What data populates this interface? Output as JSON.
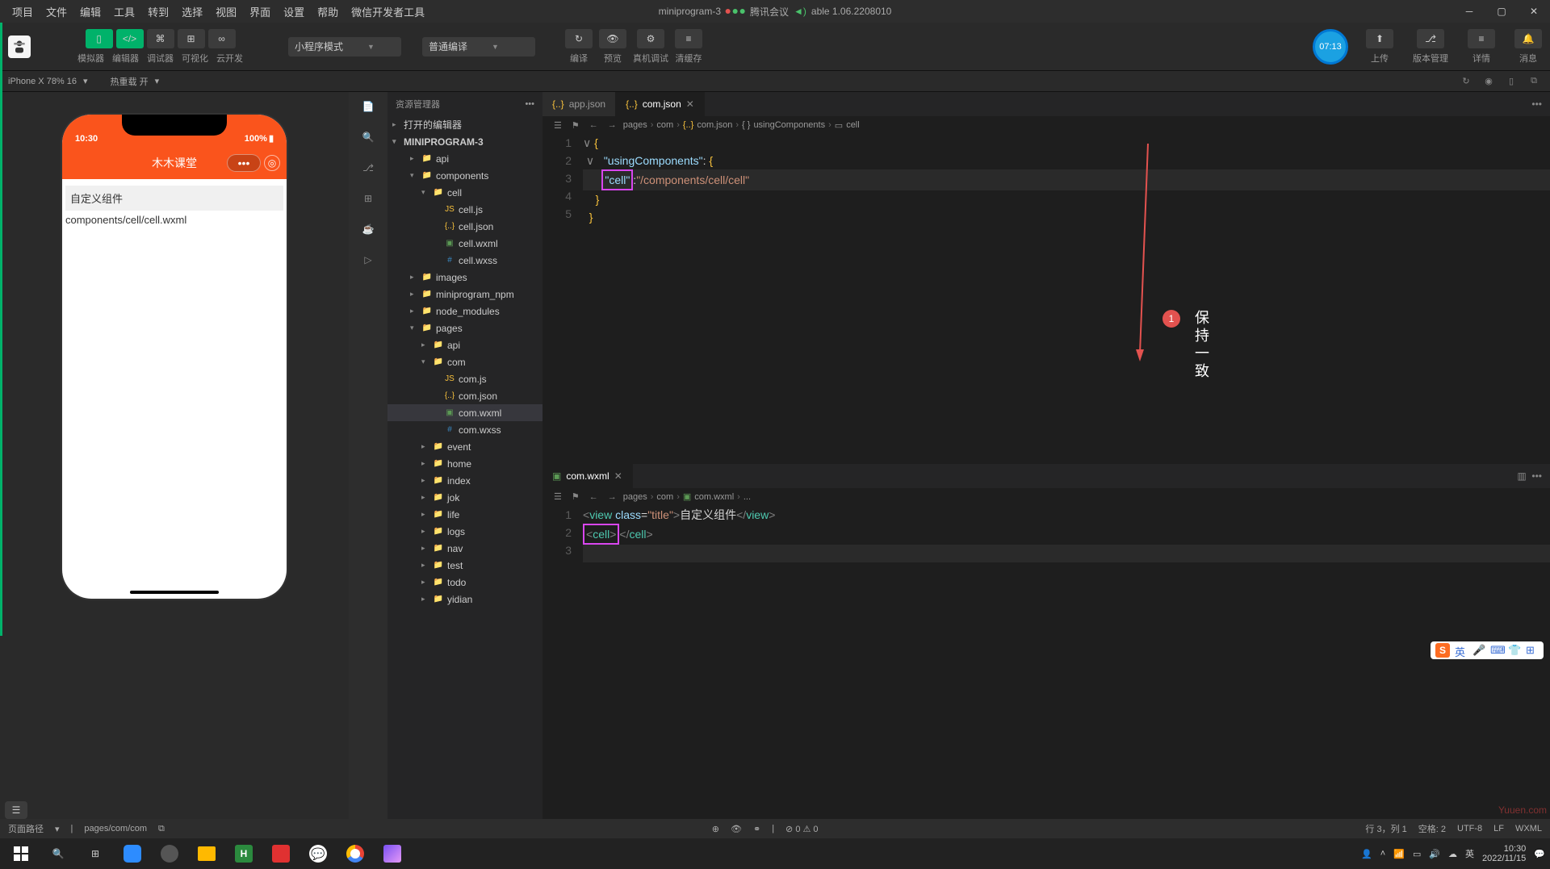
{
  "menubar": {
    "items": [
      "项目",
      "文件",
      "编辑",
      "工具",
      "转到",
      "选择",
      "视图",
      "界面",
      "设置",
      "帮助",
      "微信开发者工具"
    ],
    "projectName": "miniprogram-3",
    "meetingLabel": "腾讯会议",
    "versionLabel": "able 1.06.2208010"
  },
  "toolbar": {
    "group1Labels": [
      "模拟器",
      "编辑器",
      "调试器",
      "可视化",
      "云开发"
    ],
    "dropdown1": "小程序模式",
    "dropdown2": "普通编译",
    "group2Labels": [
      "编译",
      "预览",
      "真机调试",
      "清缓存"
    ],
    "rightLabels": [
      "上传",
      "版本管理",
      "详情",
      "消息"
    ],
    "badgeTime": "07:13"
  },
  "subToolbar": {
    "device": "iPhone X 78% 16",
    "hotReload": "热重载 开"
  },
  "phone": {
    "time": "10:30",
    "battery": "100%",
    "title": "木木课堂",
    "contentTitle": "自定义组件",
    "contentPath": "components/cell/cell.wxml"
  },
  "explorer": {
    "header": "资源管理器",
    "section1": "打开的编辑器",
    "root": "MINIPROGRAM-3",
    "tree": [
      {
        "name": "api",
        "type": "folder",
        "depth": 1,
        "open": false
      },
      {
        "name": "components",
        "type": "folder",
        "depth": 1,
        "open": true
      },
      {
        "name": "cell",
        "type": "folder",
        "depth": 2,
        "open": true
      },
      {
        "name": "cell.js",
        "type": "js",
        "depth": 3
      },
      {
        "name": "cell.json",
        "type": "json",
        "depth": 3
      },
      {
        "name": "cell.wxml",
        "type": "wxml",
        "depth": 3
      },
      {
        "name": "cell.wxss",
        "type": "wxss",
        "depth": 3
      },
      {
        "name": "images",
        "type": "folder",
        "depth": 1,
        "open": false
      },
      {
        "name": "miniprogram_npm",
        "type": "folder",
        "depth": 1,
        "open": false
      },
      {
        "name": "node_modules",
        "type": "folder",
        "depth": 1,
        "open": false
      },
      {
        "name": "pages",
        "type": "folder",
        "depth": 1,
        "open": true
      },
      {
        "name": "api",
        "type": "folder",
        "depth": 2,
        "open": false
      },
      {
        "name": "com",
        "type": "folder",
        "depth": 2,
        "open": true
      },
      {
        "name": "com.js",
        "type": "js",
        "depth": 3
      },
      {
        "name": "com.json",
        "type": "json",
        "depth": 3
      },
      {
        "name": "com.wxml",
        "type": "wxml",
        "depth": 3,
        "selected": true
      },
      {
        "name": "com.wxss",
        "type": "wxss",
        "depth": 3
      },
      {
        "name": "event",
        "type": "folder",
        "depth": 2,
        "open": false
      },
      {
        "name": "home",
        "type": "folder",
        "depth": 2,
        "open": false
      },
      {
        "name": "index",
        "type": "folder",
        "depth": 2,
        "open": false
      },
      {
        "name": "jok",
        "type": "folder",
        "depth": 2,
        "open": false
      },
      {
        "name": "life",
        "type": "folder",
        "depth": 2,
        "open": false
      },
      {
        "name": "logs",
        "type": "folder",
        "depth": 2,
        "open": false
      },
      {
        "name": "nav",
        "type": "folder",
        "depth": 2,
        "open": false
      },
      {
        "name": "test",
        "type": "folder",
        "depth": 2,
        "open": false
      },
      {
        "name": "todo",
        "type": "folder",
        "depth": 2,
        "open": false
      },
      {
        "name": "yidian",
        "type": "folder",
        "depth": 2,
        "open": false
      }
    ]
  },
  "editor1": {
    "tab1": "app.json",
    "tab2": "com.json",
    "breadcrumb": [
      "pages",
      "com",
      "com.json",
      "usingComponents",
      "cell"
    ],
    "lines": [
      "1",
      "2",
      "3",
      "4",
      "5"
    ],
    "code": {
      "usingComponents": "\"usingComponents\"",
      "cellKey": "\"cell\"",
      "cellVal": "\"/components/cell/cell\""
    }
  },
  "annotation": {
    "num": "1",
    "text": "保持一致"
  },
  "editor2": {
    "tab1": "com.wxml",
    "breadcrumb": [
      "pages",
      "com",
      "com.wxml",
      "..."
    ],
    "lines": [
      "1",
      "2",
      "3"
    ],
    "code": {
      "viewOpen": "<view ",
      "classAttr": "class=",
      "classVal": "\"title\"",
      "viewText": "自定义组件",
      "viewClose": "</view>",
      "cellOpen": "<cell>",
      "cellClose": "</cell>"
    }
  },
  "statusbar": {
    "pagePath": "页面路径",
    "path": "pages/com/com",
    "errors": "⊘ 0 ⚠ 0",
    "cursor": "行 3，列 1",
    "spaces": "空格: 2",
    "encoding": "UTF-8",
    "eol": "LF",
    "lang": "WXML"
  },
  "taskbar": {
    "time": "10:30",
    "date": "2022/11/15",
    "lang": "英"
  },
  "watermark": "Yuuen.com"
}
